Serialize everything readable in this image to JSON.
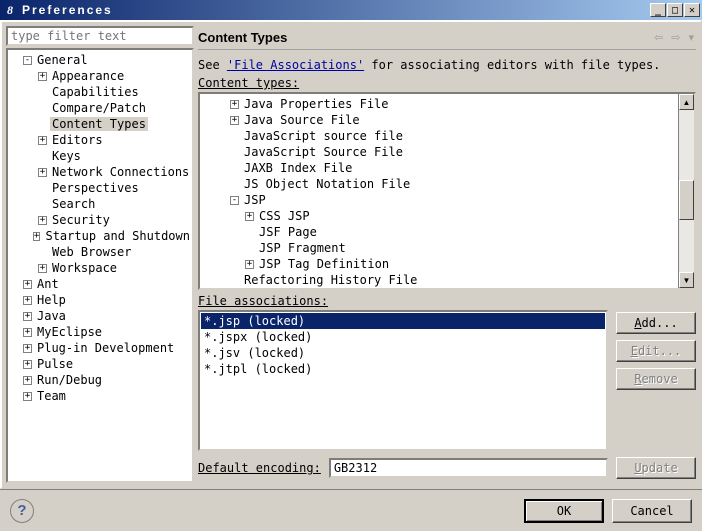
{
  "titlebar": {
    "title": "Preferences"
  },
  "filter": {
    "placeholder": "type filter text"
  },
  "left_tree": [
    {
      "indent": 0,
      "exp": "-",
      "label": "General",
      "sel": false
    },
    {
      "indent": 1,
      "exp": "+",
      "label": "Appearance",
      "sel": false
    },
    {
      "indent": 1,
      "exp": "",
      "label": "Capabilities",
      "sel": false
    },
    {
      "indent": 1,
      "exp": "",
      "label": "Compare/Patch",
      "sel": false
    },
    {
      "indent": 1,
      "exp": "",
      "label": "Content Types",
      "sel": true
    },
    {
      "indent": 1,
      "exp": "+",
      "label": "Editors",
      "sel": false
    },
    {
      "indent": 1,
      "exp": "",
      "label": "Keys",
      "sel": false
    },
    {
      "indent": 1,
      "exp": "+",
      "label": "Network Connections",
      "sel": false
    },
    {
      "indent": 1,
      "exp": "",
      "label": "Perspectives",
      "sel": false
    },
    {
      "indent": 1,
      "exp": "",
      "label": "Search",
      "sel": false
    },
    {
      "indent": 1,
      "exp": "+",
      "label": "Security",
      "sel": false
    },
    {
      "indent": 1,
      "exp": "+",
      "label": "Startup and Shutdown",
      "sel": false
    },
    {
      "indent": 1,
      "exp": "",
      "label": "Web Browser",
      "sel": false
    },
    {
      "indent": 1,
      "exp": "+",
      "label": "Workspace",
      "sel": false
    },
    {
      "indent": 0,
      "exp": "+",
      "label": "Ant",
      "sel": false
    },
    {
      "indent": 0,
      "exp": "+",
      "label": "Help",
      "sel": false
    },
    {
      "indent": 0,
      "exp": "+",
      "label": "Java",
      "sel": false
    },
    {
      "indent": 0,
      "exp": "+",
      "label": "MyEclipse",
      "sel": false
    },
    {
      "indent": 0,
      "exp": "+",
      "label": "Plug-in Development",
      "sel": false
    },
    {
      "indent": 0,
      "exp": "+",
      "label": "Pulse",
      "sel": false
    },
    {
      "indent": 0,
      "exp": "+",
      "label": "Run/Debug",
      "sel": false
    },
    {
      "indent": 0,
      "exp": "+",
      "label": "Team",
      "sel": false
    }
  ],
  "heading": "Content Types",
  "description": {
    "prefix": "See ",
    "link": "'File Associations'",
    "suffix": " for associating editors with file types."
  },
  "ct_label": "Content types:",
  "ct_tree": [
    {
      "indent": 1,
      "exp": "+",
      "label": "Java Properties File"
    },
    {
      "indent": 1,
      "exp": "+",
      "label": "Java Source File"
    },
    {
      "indent": 1,
      "exp": "",
      "label": "JavaScript source file"
    },
    {
      "indent": 1,
      "exp": "",
      "label": "JavaScript Source File"
    },
    {
      "indent": 1,
      "exp": "",
      "label": "JAXB Index File"
    },
    {
      "indent": 1,
      "exp": "",
      "label": "JS Object Notation File"
    },
    {
      "indent": 1,
      "exp": "-",
      "label": "JSP"
    },
    {
      "indent": 2,
      "exp": "+",
      "label": "CSS JSP"
    },
    {
      "indent": 2,
      "exp": "",
      "label": "JSF Page"
    },
    {
      "indent": 2,
      "exp": "",
      "label": "JSP Fragment"
    },
    {
      "indent": 2,
      "exp": "+",
      "label": "JSP Tag Definition"
    },
    {
      "indent": 1,
      "exp": "",
      "label": "Refactoring History File"
    }
  ],
  "fa_label": "File associations:",
  "fa_items": [
    {
      "label": "*.jsp (locked)",
      "sel": true
    },
    {
      "label": "*.jspx (locked)",
      "sel": false
    },
    {
      "label": "*.jsv (locked)",
      "sel": false
    },
    {
      "label": "*.jtpl (locked)",
      "sel": false
    }
  ],
  "buttons": {
    "add": "Add...",
    "edit": "Edit...",
    "remove": "Remove",
    "update": "Update",
    "ok": "OK",
    "cancel": "Cancel"
  },
  "encoding": {
    "label": "Default encoding:",
    "value": "GB2312"
  }
}
